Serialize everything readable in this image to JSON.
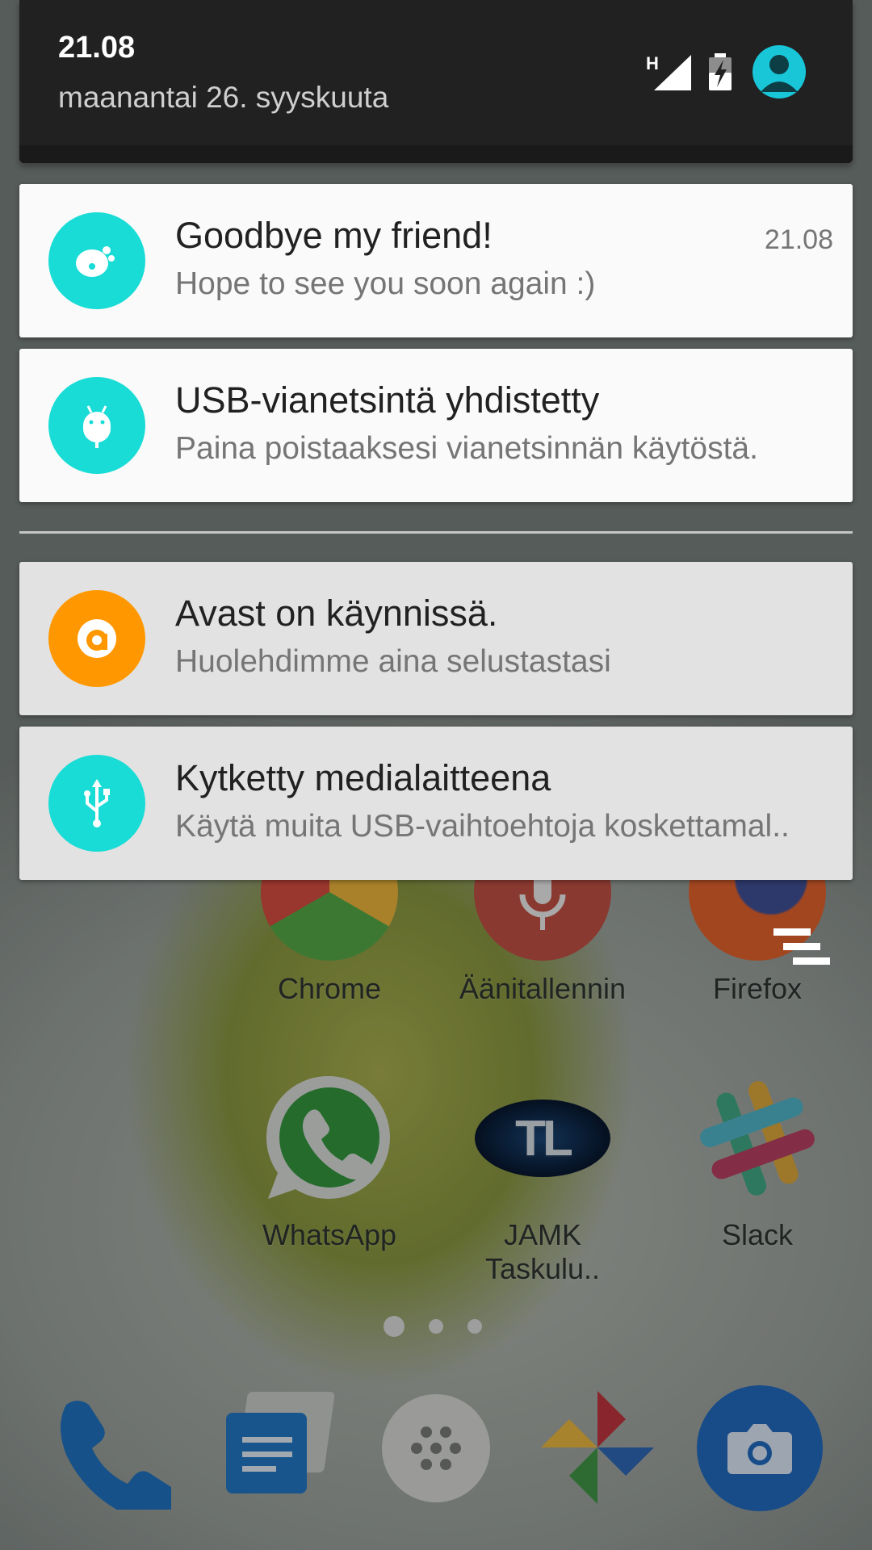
{
  "header": {
    "time": "21.08",
    "date": "maanantai 26. syyskuuta",
    "network_type": "H"
  },
  "notifications_top": [
    {
      "title": "Goodbye my friend!",
      "text": "Hope to see you soon again :)",
      "time": "21.08",
      "icon": "app-blob-icon",
      "icon_color": "#19dcd6"
    },
    {
      "title": "USB-vianetsintä yhdistetty",
      "text": "Paina poistaaksesi vianetsinnän käytöstä.",
      "icon": "android-debug-icon",
      "icon_color": "#19dcd6"
    }
  ],
  "notifications_bottom": [
    {
      "title": "Avast on käynnissä.",
      "text": "Huolehdimme aina selustastasi",
      "icon": "avast-icon",
      "icon_color": "#ff9800"
    },
    {
      "title": "Kytketty medialaitteena",
      "text": "Käytä muita USB-vaihtoehtoja koskettamal..",
      "icon": "usb-icon",
      "icon_color": "#19dcd6"
    }
  ],
  "home_apps": [
    {
      "label": "Chrome",
      "icon": "chrome-icon"
    },
    {
      "label": "Äänitallennin",
      "icon": "mic-icon"
    },
    {
      "label": "Firefox",
      "icon": "firefox-icon"
    },
    {
      "label": "WhatsApp",
      "icon": "whatsapp-icon"
    },
    {
      "label": "JAMK Taskulu..",
      "icon": "jamk-tl-icon"
    },
    {
      "label": "Slack",
      "icon": "slack-icon"
    }
  ],
  "jamk_logo_text": "TL",
  "page_indicator": {
    "pages": 3,
    "current": 1
  },
  "dock": [
    "phone-icon",
    "messages-icon",
    "app-drawer-icon",
    "photos-icon",
    "camera-icon"
  ],
  "colors": {
    "header_bg": "#212121",
    "accent_teal": "#19dcd6",
    "avatar_blue": "#18c6d8",
    "avast_orange": "#ff9800"
  }
}
